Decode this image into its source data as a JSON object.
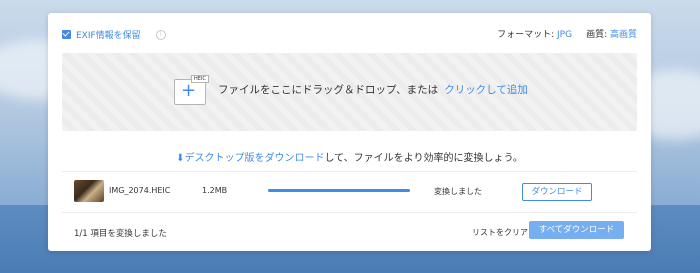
{
  "header": {
    "exif_label": "EXIF情報を保留",
    "exif_checked": true,
    "format_label": "フォーマット:",
    "format_value": "JPG",
    "quality_label": "画質:",
    "quality_value": "高画質"
  },
  "dropzone": {
    "file_badge": "HEIC",
    "text": "ファイルをここにドラッグ＆ドロップ、または",
    "click_link": "クリックして追加"
  },
  "promo": {
    "link_text": "デスクトップ版をダウンロード",
    "rest_text": "して、ファイルをより効率的に変換しょう。"
  },
  "files": [
    {
      "name": "IMG_2074.HEIC",
      "size": "1.2MB",
      "progress": 1.0,
      "status": "変換しました",
      "download_label": "ダウンロード"
    }
  ],
  "footer": {
    "summary": "1/1 項目を変換しました",
    "clear_label": "リストをクリア",
    "download_all_label": "すべてダウンロード"
  },
  "colors": {
    "accent": "#3f8be8",
    "accent_light": "#76aef0"
  }
}
